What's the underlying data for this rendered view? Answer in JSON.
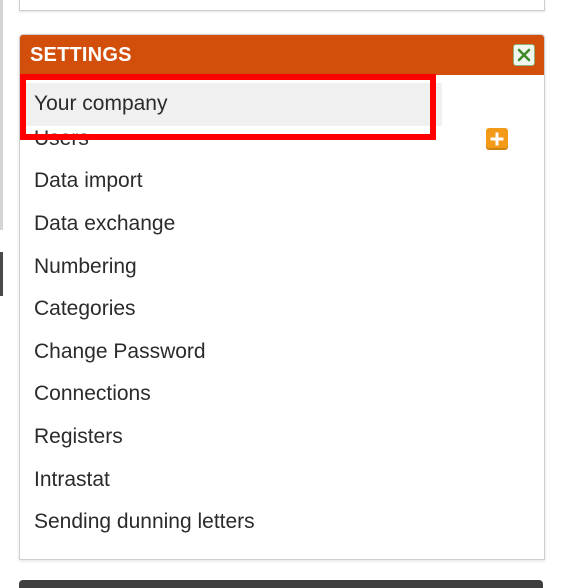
{
  "settings": {
    "title": "SETTINGS",
    "close_icon": "close-icon",
    "items": [
      {
        "label": "Your company",
        "active": true
      },
      {
        "label": "Users",
        "action_icon": "add-icon"
      },
      {
        "label": "Data import"
      },
      {
        "label": "Data exchange"
      },
      {
        "label": "Numbering"
      },
      {
        "label": "Categories"
      },
      {
        "label": "Change Password"
      },
      {
        "label": "Connections"
      },
      {
        "label": "Registers"
      },
      {
        "label": "Intrastat"
      },
      {
        "label": "Sending dunning letters"
      }
    ]
  },
  "colors": {
    "header_bg": "#d14f0a",
    "highlight": "#ff0000",
    "add_icon": "#f39a19",
    "close_icon_green": "#3f8a2a"
  }
}
